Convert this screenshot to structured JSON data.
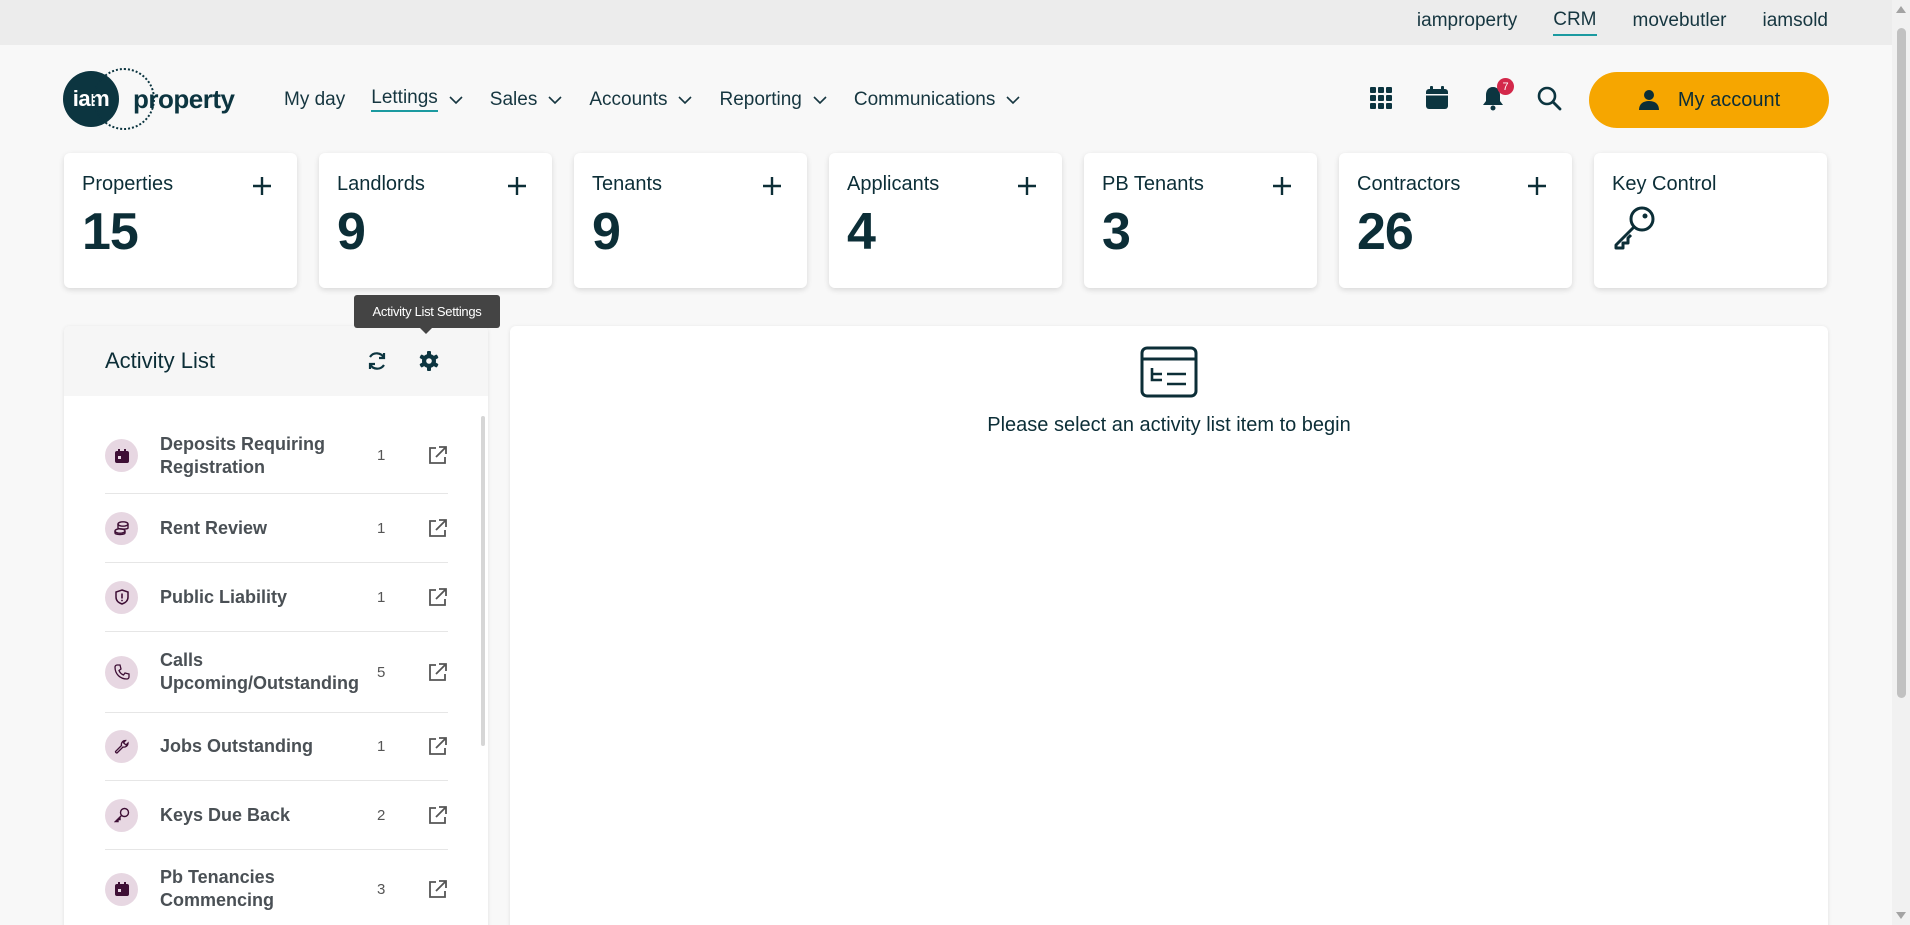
{
  "topbar": {
    "links": [
      {
        "label": "iamproperty"
      },
      {
        "label": "CRM"
      },
      {
        "label": "movebutler"
      },
      {
        "label": "iamsold"
      }
    ]
  },
  "logo": {
    "circle_text": "iam",
    "word": "property"
  },
  "nav": {
    "items": [
      {
        "label": "My day"
      },
      {
        "label": "Lettings"
      },
      {
        "label": "Sales"
      },
      {
        "label": "Accounts"
      },
      {
        "label": "Reporting"
      },
      {
        "label": "Communications"
      }
    ]
  },
  "header": {
    "notification_count": "7",
    "my_account_label": "My account"
  },
  "cards": [
    {
      "title": "Properties",
      "value": "15"
    },
    {
      "title": "Landlords",
      "value": "9"
    },
    {
      "title": "Tenants",
      "value": "9"
    },
    {
      "title": "Applicants",
      "value": "4"
    },
    {
      "title": "PB Tenants",
      "value": "3"
    },
    {
      "title": "Contractors",
      "value": "26"
    },
    {
      "title": "Key Control",
      "value": ""
    }
  ],
  "activity": {
    "title": "Activity List",
    "tooltip": "Activity List Settings",
    "items": [
      {
        "label": "Deposits Requiring Registration",
        "count": "1",
        "icon": "calendar-icon"
      },
      {
        "label": "Rent Review",
        "count": "1",
        "icon": "coins-icon"
      },
      {
        "label": "Public Liability",
        "count": "1",
        "icon": "shield-icon"
      },
      {
        "label": "Calls Upcoming/Outstanding",
        "count": "5",
        "icon": "phone-icon"
      },
      {
        "label": "Jobs Outstanding",
        "count": "1",
        "icon": "wrench-icon"
      },
      {
        "label": "Keys Due Back",
        "count": "2",
        "icon": "key-icon"
      },
      {
        "label": "Pb Tenancies Commencing",
        "count": "3",
        "icon": "calendar-icon"
      }
    ]
  },
  "main": {
    "message": "Please select an activity list item to begin"
  },
  "colors": {
    "brand_dark": "#0c3540",
    "accent_button": "#f6a600",
    "underline": "#1b9aa0",
    "badge": "#d3284a",
    "icon_bg": "#e7d7e2"
  }
}
